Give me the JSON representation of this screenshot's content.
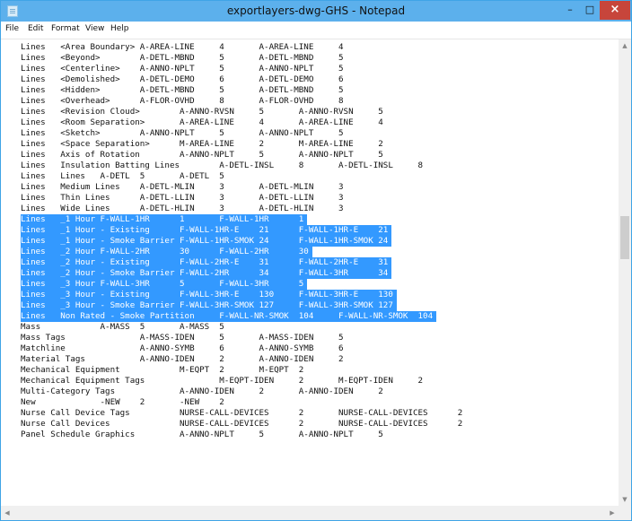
{
  "window": {
    "title": "exportlayers-dwg-GHS - Notepad",
    "controls": {
      "minimize": "–",
      "maximize": "□",
      "close": "×"
    }
  },
  "menu": [
    "File",
    "Edit",
    "Format",
    "View",
    "Help"
  ],
  "lines": [
    "Lines   <Area Boundary> A-AREA-LINE     4       A-AREA-LINE     4",
    "Lines   <Beyond>        A-DETL-MBND     5       A-DETL-MBND     5",
    "Lines   <Centerline>    A-ANNO-NPLT     5       A-ANNO-NPLT     5",
    "Lines   <Demolished>    A-DETL-DEMO     6       A-DETL-DEMO     6",
    "Lines   <Hidden>        A-DETL-MBND     5       A-DETL-MBND     5",
    "Lines   <Overhead>      A-FLOR-OVHD     8       A-FLOR-OVHD     8",
    "Lines   <Revision Cloud>        A-ANNO-RVSN     5       A-ANNO-RVSN     5",
    "Lines   <Room Separation>       A-AREA-LINE     4       A-AREA-LINE     4",
    "Lines   <Sketch>        A-ANNO-NPLT     5       A-ANNO-NPLT     5",
    "Lines   <Space Separation>      M-AREA-LINE     2       M-AREA-LINE     2",
    "Lines   Axis of Rotation        A-ANNO-NPLT     5       A-ANNO-NPLT     5",
    "Lines   Insulation Batting Lines        A-DETL-INSL     8       A-DETL-INSL     8",
    "Lines   Lines   A-DETL  5       A-DETL  5",
    "Lines   Medium Lines    A-DETL-MLIN     3       A-DETL-MLIN     3",
    "Lines   Thin Lines      A-DETL-LLIN     3       A-DETL-LLIN     3",
    "Lines   Wide Lines      A-DETL-HLIN     3       A-DETL-HLIN     3",
    "Lines   _1 Hour F-WALL-1HR      1       F-WALL-1HR      1",
    "Lines   _1 Hour - Existing      F-WALL-1HR-E    21      F-WALL-1HR-E    21",
    "Lines   _1 Hour - Smoke Barrier F-WALL-1HR-SMOK 24      F-WALL-1HR-SMOK 24",
    "Lines   _2 Hour F-WALL-2HR      30      F-WALL-2HR      30",
    "Lines   _2 Hour - Existing      F-WALL-2HR-E    31      F-WALL-2HR-E    31",
    "Lines   _2 Hour - Smoke Barrier F-WALL-2HR      34      F-WALL-3HR      34",
    "Lines   _3 Hour F-WALL-3HR      5       F-WALL-3HR      5",
    "Lines   _3 Hour - Existing      F-WALL-3HR-E    130     F-WALL-3HR-E    130",
    "Lines   _3 Hour - Smoke Barrier F-WALL-3HR-SMOK 127     F-WALL-3HR-SMOK 127",
    "Lines   Non Rated - Smoke Partition     F-WALL-NR-SMOK  104     F-WALL-NR-SMOK  104",
    "Mass            A-MASS  5       A-MASS  5",
    "Mass Tags               A-MASS-IDEN     5       A-MASS-IDEN     5",
    "Matchline               A-ANNO-SYMB     6       A-ANNO-SYMB     6",
    "Material Tags           A-ANNO-IDEN     2       A-ANNO-IDEN     2",
    "Mechanical Equipment            M-EQPT  2       M-EQPT  2",
    "Mechanical Equipment Tags               M-EQPT-IDEN     2       M-EQPT-IDEN     2",
    "Multi-Category Tags             A-ANNO-IDEN     2       A-ANNO-IDEN     2",
    "New             -NEW    2       -NEW    2",
    "Nurse Call Device Tags          NURSE-CALL-DEVICES      2       NURSE-CALL-DEVICES      2",
    "Nurse Call Devices              NURSE-CALL-DEVICES      2       NURSE-CALL-DEVICES      2",
    "Panel Schedule Graphics         A-ANNO-NPLT     5       A-ANNO-NPLT     5"
  ],
  "selection": {
    "first_line": 16,
    "last_line": 25
  },
  "colors": {
    "titlebar": "#5cb0ec",
    "selection": "#3399ff",
    "close": "#c7453b"
  }
}
